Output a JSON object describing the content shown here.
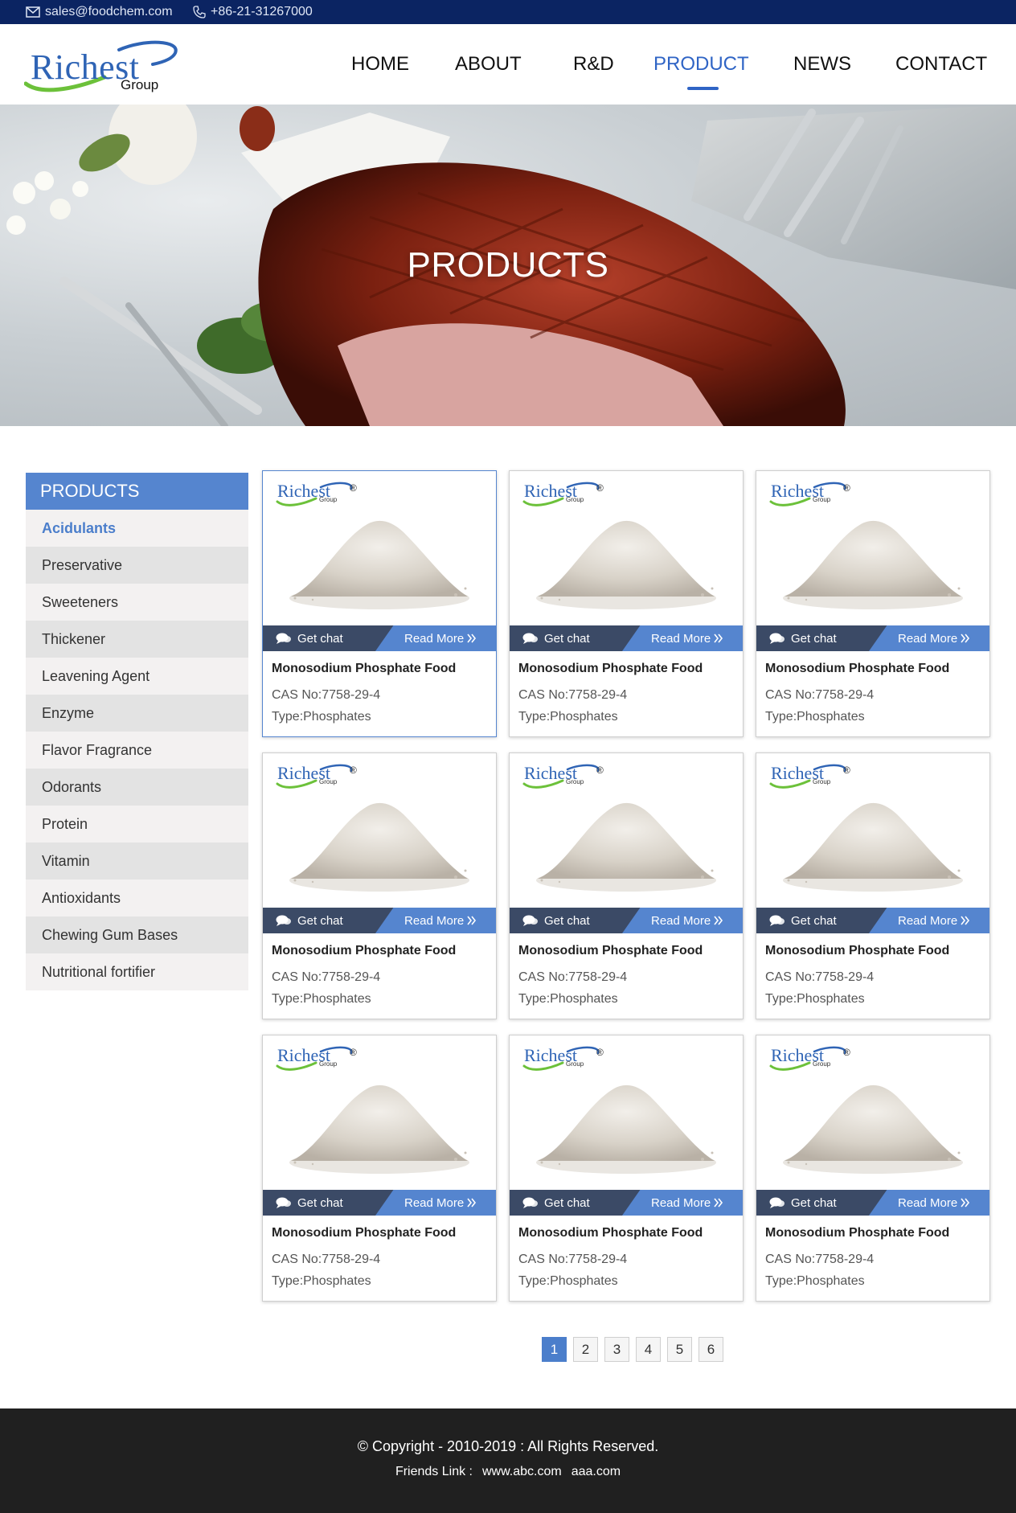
{
  "topbar": {
    "email": "sales@foodchem.com",
    "phone": "+86-21-31267000",
    "bg_color": "#0b2462"
  },
  "logo": {
    "name": "Richest",
    "sub": "Group"
  },
  "nav": {
    "items": [
      {
        "label": "HOME",
        "icon": ""
      },
      {
        "label": "ABOUT",
        "icon": ""
      },
      {
        "label": "R&D",
        "icon": ""
      },
      {
        "label": "PRODUCT",
        "icon": ""
      },
      {
        "label": "NEWS",
        "icon": ""
      },
      {
        "label": "CONTACT",
        "icon": ""
      }
    ],
    "active_index": 3,
    "accent": "#2f64c5"
  },
  "banner": {
    "title": "PRODUCTS"
  },
  "sidebar": {
    "title": "PRODUCTS",
    "active_index": 0,
    "items": [
      {
        "label": "Acidulants"
      },
      {
        "label": "Preservative"
      },
      {
        "label": "Sweeteners"
      },
      {
        "label": "Thickener"
      },
      {
        "label": "Leavening Agent"
      },
      {
        "label": "Enzyme"
      },
      {
        "label": "Flavor Fragrance"
      },
      {
        "label": "Odorants"
      },
      {
        "label": "Protein"
      },
      {
        "label": "Vitamin"
      },
      {
        "label": "Antioxidants"
      },
      {
        "label": "Chewing Gum Bases"
      },
      {
        "label": "Nutritional fortifier"
      }
    ]
  },
  "product_card": {
    "brand": "Richest",
    "brand_sub": "Group",
    "reg_mark": "®",
    "chat_label": "Get chat",
    "more_label": "Read More",
    "chat_icon": "chat-bubble-icon",
    "more_icon": "double-chevron-right-icon"
  },
  "products": [
    {
      "name": "Monosodium Phosphate Food",
      "cas": "CAS No:7758-29-4",
      "type": "Type:Phosphates"
    },
    {
      "name": "Monosodium Phosphate Food",
      "cas": "CAS No:7758-29-4",
      "type": "Type:Phosphates"
    },
    {
      "name": "Monosodium Phosphate Food",
      "cas": "CAS No:7758-29-4",
      "type": "Type:Phosphates"
    },
    {
      "name": "Monosodium Phosphate Food",
      "cas": "CAS No:7758-29-4",
      "type": "Type:Phosphates"
    },
    {
      "name": "Monosodium Phosphate Food",
      "cas": "CAS No:7758-29-4",
      "type": "Type:Phosphates"
    },
    {
      "name": "Monosodium Phosphate Food",
      "cas": "CAS No:7758-29-4",
      "type": "Type:Phosphates"
    },
    {
      "name": "Monosodium Phosphate Food",
      "cas": "CAS No:7758-29-4",
      "type": "Type:Phosphates"
    },
    {
      "name": "Monosodium Phosphate Food",
      "cas": "CAS No:7758-29-4",
      "type": "Type:Phosphates"
    },
    {
      "name": "Monosodium Phosphate Food",
      "cas": "CAS No:7758-29-4",
      "type": "Type:Phosphates"
    }
  ],
  "pagination": {
    "pages": [
      "1",
      "2",
      "3",
      "4",
      "5",
      "6"
    ],
    "current": "1"
  },
  "footer": {
    "copyright": "© Copyright - 2010-2019 : All Rights Reserved.",
    "friends_label": "Friends Link :",
    "links": [
      "www.abc.com",
      "aaa.com"
    ]
  }
}
